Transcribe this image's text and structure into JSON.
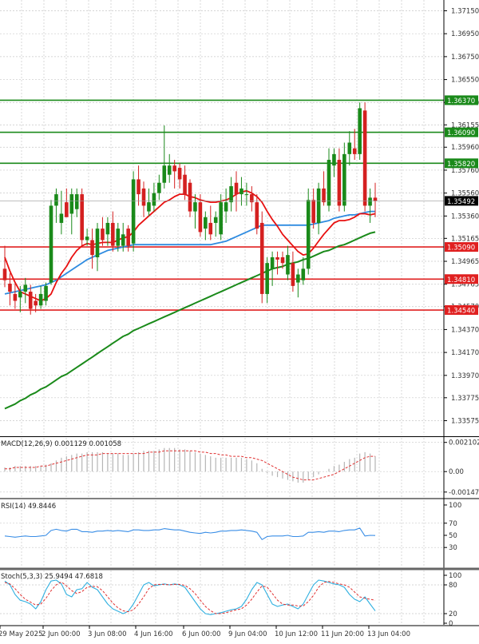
{
  "chart_data": {
    "type": "candlestick",
    "price_panel": {
      "ylim": [
        1.3346,
        1.3723
      ],
      "y_ticks": [
        "1.37150",
        "1.36950",
        "1.36750",
        "1.36550",
        "1.36350",
        "1.36155",
        "1.35960",
        "1.35760",
        "1.35560",
        "1.35360",
        "1.35165",
        "1.34965",
        "1.34765",
        "1.34570",
        "1.34370",
        "1.34170",
        "1.33970",
        "1.33775",
        "1.33575"
      ],
      "candles": [
        {
          "o": 1.349,
          "h": 1.351,
          "l": 1.3474,
          "c": 1.348
        },
        {
          "o": 1.3477,
          "h": 1.3486,
          "l": 1.3458,
          "c": 1.347
        },
        {
          "o": 1.3468,
          "h": 1.3478,
          "l": 1.3455,
          "c": 1.3462
        },
        {
          "o": 1.3465,
          "h": 1.3475,
          "l": 1.3452,
          "c": 1.347
        },
        {
          "o": 1.347,
          "h": 1.3482,
          "l": 1.346,
          "c": 1.3476
        },
        {
          "o": 1.347,
          "h": 1.3476,
          "l": 1.345,
          "c": 1.3455
        },
        {
          "o": 1.3462,
          "h": 1.3468,
          "l": 1.3452,
          "c": 1.3458
        },
        {
          "o": 1.3458,
          "h": 1.3475,
          "l": 1.3455,
          "c": 1.3468
        },
        {
          "o": 1.3462,
          "h": 1.3478,
          "l": 1.3458,
          "c": 1.3475
        },
        {
          "o": 1.3478,
          "h": 1.355,
          "l": 1.3476,
          "c": 1.3545
        },
        {
          "o": 1.3545,
          "h": 1.356,
          "l": 1.353,
          "c": 1.3555
        },
        {
          "o": 1.353,
          "h": 1.3558,
          "l": 1.352,
          "c": 1.3538
        },
        {
          "o": 1.3548,
          "h": 1.356,
          "l": 1.3535,
          "c": 1.3535
        },
        {
          "o": 1.3538,
          "h": 1.356,
          "l": 1.352,
          "c": 1.3555
        },
        {
          "o": 1.3542,
          "h": 1.356,
          "l": 1.3535,
          "c": 1.3555
        },
        {
          "o": 1.3555,
          "h": 1.356,
          "l": 1.351,
          "c": 1.3515
        },
        {
          "o": 1.3515,
          "h": 1.3525,
          "l": 1.351,
          "c": 1.3518
        },
        {
          "o": 1.3515,
          "h": 1.3525,
          "l": 1.349,
          "c": 1.3502
        },
        {
          "o": 1.35,
          "h": 1.353,
          "l": 1.3488,
          "c": 1.3525
        },
        {
          "o": 1.3525,
          "h": 1.3535,
          "l": 1.351,
          "c": 1.3515
        },
        {
          "o": 1.352,
          "h": 1.3535,
          "l": 1.351,
          "c": 1.353
        },
        {
          "o": 1.353,
          "h": 1.354,
          "l": 1.3505,
          "c": 1.351
        },
        {
          "o": 1.351,
          "h": 1.353,
          "l": 1.3505,
          "c": 1.3525
        },
        {
          "o": 1.351,
          "h": 1.353,
          "l": 1.3505,
          "c": 1.352
        },
        {
          "o": 1.3525,
          "h": 1.3528,
          "l": 1.3505,
          "c": 1.351
        },
        {
          "o": 1.3512,
          "h": 1.3575,
          "l": 1.3505,
          "c": 1.3568
        },
        {
          "o": 1.3568,
          "h": 1.358,
          "l": 1.3545,
          "c": 1.3555
        },
        {
          "o": 1.356,
          "h": 1.3566,
          "l": 1.3535,
          "c": 1.3545
        },
        {
          "o": 1.354,
          "h": 1.356,
          "l": 1.3536,
          "c": 1.3548
        },
        {
          "o": 1.3545,
          "h": 1.3565,
          "l": 1.354,
          "c": 1.3556
        },
        {
          "o": 1.3556,
          "h": 1.3572,
          "l": 1.355,
          "c": 1.3565
        },
        {
          "o": 1.3565,
          "h": 1.3615,
          "l": 1.356,
          "c": 1.358
        },
        {
          "o": 1.3572,
          "h": 1.359,
          "l": 1.3565,
          "c": 1.358
        },
        {
          "o": 1.358,
          "h": 1.3585,
          "l": 1.356,
          "c": 1.3575
        },
        {
          "o": 1.3578,
          "h": 1.3582,
          "l": 1.356,
          "c": 1.3568
        },
        {
          "o": 1.3572,
          "h": 1.358,
          "l": 1.355,
          "c": 1.3555
        },
        {
          "o": 1.3565,
          "h": 1.3568,
          "l": 1.3535,
          "c": 1.354
        },
        {
          "o": 1.354,
          "h": 1.3555,
          "l": 1.3525,
          "c": 1.3548
        },
        {
          "o": 1.3548,
          "h": 1.3555,
          "l": 1.3518,
          "c": 1.3522
        },
        {
          "o": 1.3525,
          "h": 1.354,
          "l": 1.3515,
          "c": 1.3535
        },
        {
          "o": 1.353,
          "h": 1.3545,
          "l": 1.3515,
          "c": 1.352
        },
        {
          "o": 1.353,
          "h": 1.354,
          "l": 1.3518,
          "c": 1.3535
        },
        {
          "o": 1.352,
          "h": 1.3555,
          "l": 1.3515,
          "c": 1.3548
        },
        {
          "o": 1.354,
          "h": 1.356,
          "l": 1.353,
          "c": 1.3548
        },
        {
          "o": 1.3548,
          "h": 1.357,
          "l": 1.354,
          "c": 1.3562
        },
        {
          "o": 1.3565,
          "h": 1.3575,
          "l": 1.354,
          "c": 1.3555
        },
        {
          "o": 1.3555,
          "h": 1.357,
          "l": 1.3545,
          "c": 1.356
        },
        {
          "o": 1.3555,
          "h": 1.3565,
          "l": 1.3545,
          "c": 1.3555
        },
        {
          "o": 1.3555,
          "h": 1.3562,
          "l": 1.354,
          "c": 1.3548
        },
        {
          "o": 1.3548,
          "h": 1.3555,
          "l": 1.352,
          "c": 1.3525
        },
        {
          "o": 1.353,
          "h": 1.354,
          "l": 1.346,
          "c": 1.3468
        },
        {
          "o": 1.3468,
          "h": 1.35,
          "l": 1.346,
          "c": 1.3495
        },
        {
          "o": 1.349,
          "h": 1.3505,
          "l": 1.3475,
          "c": 1.35
        },
        {
          "o": 1.35,
          "h": 1.3505,
          "l": 1.3485,
          "c": 1.3498
        },
        {
          "o": 1.35,
          "h": 1.3505,
          "l": 1.349,
          "c": 1.3495
        },
        {
          "o": 1.3485,
          "h": 1.351,
          "l": 1.348,
          "c": 1.3502
        },
        {
          "o": 1.3495,
          "h": 1.3505,
          "l": 1.347,
          "c": 1.3475
        },
        {
          "o": 1.3478,
          "h": 1.349,
          "l": 1.3465,
          "c": 1.3485
        },
        {
          "o": 1.348,
          "h": 1.35,
          "l": 1.3476,
          "c": 1.349
        },
        {
          "o": 1.349,
          "h": 1.356,
          "l": 1.3485,
          "c": 1.355
        },
        {
          "o": 1.355,
          "h": 1.356,
          "l": 1.3525,
          "c": 1.353
        },
        {
          "o": 1.353,
          "h": 1.3565,
          "l": 1.352,
          "c": 1.356
        },
        {
          "o": 1.356,
          "h": 1.3575,
          "l": 1.3545,
          "c": 1.3548
        },
        {
          "o": 1.3545,
          "h": 1.3595,
          "l": 1.354,
          "c": 1.3585
        },
        {
          "o": 1.358,
          "h": 1.3595,
          "l": 1.357,
          "c": 1.359
        },
        {
          "o": 1.3585,
          "h": 1.3595,
          "l": 1.354,
          "c": 1.3545
        },
        {
          "o": 1.3545,
          "h": 1.36,
          "l": 1.354,
          "c": 1.359
        },
        {
          "o": 1.359,
          "h": 1.361,
          "l": 1.358,
          "c": 1.36
        },
        {
          "o": 1.3595,
          "h": 1.3612,
          "l": 1.3585,
          "c": 1.359
        },
        {
          "o": 1.359,
          "h": 1.3635,
          "l": 1.3585,
          "c": 1.363
        },
        {
          "o": 1.3628,
          "h": 1.3635,
          "l": 1.354,
          "c": 1.3545
        },
        {
          "o": 1.3545,
          "h": 1.356,
          "l": 1.353,
          "c": 1.3552
        },
        {
          "o": 1.3552,
          "h": 1.3565,
          "l": 1.3535,
          "c": 1.3549
        }
      ],
      "ma_fast": [
        1.35,
        1.3488,
        1.3478,
        1.347,
        1.3468,
        1.3466,
        1.3464,
        1.3462,
        1.3464,
        1.3468,
        1.3478,
        1.3486,
        1.3492,
        1.35,
        1.3506,
        1.351,
        1.3512,
        1.3511,
        1.3512,
        1.3513,
        1.3513,
        1.3513,
        1.3515,
        1.3517,
        1.3518,
        1.3522,
        1.3528,
        1.3532,
        1.3536,
        1.354,
        1.3544,
        1.3548,
        1.355,
        1.3553,
        1.3555,
        1.3555,
        1.3553,
        1.3552,
        1.355,
        1.3549,
        1.3548,
        1.3548,
        1.3549,
        1.355,
        1.3552,
        1.3555,
        1.3557,
        1.3558,
        1.3556,
        1.3553,
        1.3548,
        1.354,
        1.3533,
        1.3527,
        1.352,
        1.3515,
        1.351,
        1.3505,
        1.3502,
        1.3503,
        1.3508,
        1.3514,
        1.352,
        1.3525,
        1.353,
        1.3532,
        1.3532,
        1.3533,
        1.3535,
        1.3538,
        1.3538,
        1.3537,
        1.3538
      ],
      "ma_mid": [
        1.3468,
        1.3469,
        1.347,
        1.3471,
        1.3472,
        1.3473,
        1.3474,
        1.3475,
        1.3476,
        1.3478,
        1.348,
        1.3483,
        1.3486,
        1.3489,
        1.3492,
        1.3495,
        1.3498,
        1.35,
        1.3502,
        1.3504,
        1.3506,
        1.3507,
        1.3508,
        1.3509,
        1.351,
        1.3511,
        1.3511,
        1.3511,
        1.3511,
        1.3511,
        1.3511,
        1.3511,
        1.3511,
        1.3511,
        1.3511,
        1.3511,
        1.3511,
        1.3511,
        1.3511,
        1.3511,
        1.3511,
        1.3512,
        1.3513,
        1.3514,
        1.3516,
        1.3518,
        1.352,
        1.3522,
        1.3524,
        1.3526,
        1.3528,
        1.3528,
        1.3528,
        1.3528,
        1.3528,
        1.3528,
        1.3528,
        1.3528,
        1.3528,
        1.3528,
        1.3529,
        1.353,
        1.3531,
        1.3532,
        1.3534,
        1.3535,
        1.3536,
        1.3537,
        1.3537,
        1.3538,
        1.3539,
        1.354,
        1.354
      ],
      "ma_slow": [
        1.3368,
        1.337,
        1.3372,
        1.3375,
        1.3377,
        1.338,
        1.3382,
        1.3385,
        1.3387,
        1.339,
        1.3393,
        1.3396,
        1.3398,
        1.3401,
        1.3404,
        1.3407,
        1.341,
        1.3413,
        1.3416,
        1.3419,
        1.3422,
        1.3425,
        1.3428,
        1.3431,
        1.3433,
        1.3436,
        1.3438,
        1.344,
        1.3442,
        1.3444,
        1.3446,
        1.3448,
        1.345,
        1.3452,
        1.3454,
        1.3456,
        1.3458,
        1.346,
        1.3462,
        1.3464,
        1.3466,
        1.3468,
        1.347,
        1.3472,
        1.3474,
        1.3476,
        1.3478,
        1.348,
        1.3482,
        1.3484,
        1.3486,
        1.3488,
        1.349,
        1.3491,
        1.3492,
        1.3494,
        1.3495,
        1.3496,
        1.3498,
        1.3499,
        1.3501,
        1.3503,
        1.3505,
        1.3506,
        1.3508,
        1.351,
        1.3511,
        1.3513,
        1.3515,
        1.3517,
        1.3519,
        1.3521,
        1.3522
      ],
      "levels": [
        {
          "value": 1.3637,
          "label": "1.36370",
          "color": "#1a8a1a"
        },
        {
          "value": 1.3609,
          "label": "1.36090",
          "color": "#1a8a1a"
        },
        {
          "value": 1.3582,
          "label": "1.35820",
          "color": "#1a8a1a"
        },
        {
          "value": 1.3509,
          "label": "1.35090",
          "color": "#e02020"
        },
        {
          "value": 1.3481,
          "label": "1.34810",
          "color": "#e02020"
        },
        {
          "value": 1.3454,
          "label": "1.34540",
          "color": "#e02020"
        }
      ],
      "current_price": {
        "value": 1.35492,
        "label": "1.35492"
      }
    },
    "macd_panel": {
      "label": "MACD(12,26,9) 0.001129 0.001058",
      "ylim": [
        -0.0016,
        0.0022
      ],
      "y_ticks": [
        "0.002102",
        "0.00",
        "-0.001475"
      ],
      "histogram": [
        0.0003,
        0.0003,
        0.0004,
        0.0004,
        0.0004,
        0.0004,
        0.0004,
        0.0004,
        0.0005,
        0.0006,
        0.0008,
        0.001,
        0.0011,
        0.0012,
        0.0013,
        0.0013,
        0.0014,
        0.0014,
        0.0014,
        0.0014,
        0.0013,
        0.0013,
        0.0013,
        0.0012,
        0.0012,
        0.0013,
        0.0014,
        0.0015,
        0.0015,
        0.0015,
        0.0016,
        0.0017,
        0.0017,
        0.0017,
        0.0016,
        0.0016,
        0.0015,
        0.0014,
        0.0013,
        0.0012,
        0.0011,
        0.001,
        0.001,
        0.001,
        0.001,
        0.001,
        0.001,
        0.0009,
        0.0008,
        0.0006,
        0.0002,
        -0.0001,
        -0.0003,
        -0.0004,
        -0.0005,
        -0.0006,
        -0.0007,
        -0.0008,
        -0.0008,
        -0.0006,
        -0.0004,
        -0.0002,
        0.0,
        0.0002,
        0.0004,
        0.0005,
        0.0007,
        0.0009,
        0.001,
        0.0013,
        0.0014,
        0.0013,
        0.0011
      ],
      "signal": [
        0.0002,
        0.0002,
        0.0003,
        0.0003,
        0.0003,
        0.0003,
        0.0003,
        0.0004,
        0.0004,
        0.0005,
        0.0006,
        0.0007,
        0.0008,
        0.0009,
        0.001,
        0.0011,
        0.0012,
        0.0012,
        0.0012,
        0.0013,
        0.0013,
        0.0013,
        0.0013,
        0.0013,
        0.0013,
        0.0013,
        0.0013,
        0.0013,
        0.0014,
        0.0014,
        0.0014,
        0.0015,
        0.0015,
        0.0015,
        0.0015,
        0.0015,
        0.0015,
        0.0015,
        0.0014,
        0.0014,
        0.0013,
        0.0013,
        0.0012,
        0.0012,
        0.0011,
        0.0011,
        0.0011,
        0.001,
        0.001,
        0.0009,
        0.0008,
        0.0006,
        0.0004,
        0.0002,
        0.0,
        -0.0002,
        -0.0004,
        -0.0005,
        -0.0006,
        -0.0006,
        -0.0006,
        -0.0005,
        -0.0004,
        -0.0003,
        -0.0002,
        0.0,
        0.0002,
        0.0004,
        0.0006,
        0.0008,
        0.001,
        0.0011,
        0.0011
      ]
    },
    "rsi_panel": {
      "label": "RSI(14) 49.8446",
      "ylim": [
        0,
        100
      ],
      "y_ticks": [
        "100",
        "70",
        "50",
        "30",
        "0"
      ],
      "values": [
        49,
        48,
        47,
        48,
        49,
        48,
        48,
        49,
        50,
        58,
        60,
        58,
        57,
        60,
        60,
        56,
        56,
        55,
        57,
        57,
        58,
        57,
        58,
        57,
        56,
        59,
        59,
        58,
        58,
        59,
        59,
        61,
        60,
        59,
        59,
        57,
        55,
        54,
        53,
        55,
        54,
        55,
        57,
        57,
        58,
        58,
        59,
        58,
        57,
        55,
        43,
        48,
        49,
        49,
        49,
        50,
        48,
        48,
        49,
        55,
        55,
        56,
        55,
        57,
        57,
        56,
        58,
        59,
        59,
        62,
        49,
        50,
        49.8
      ]
    },
    "stoch_panel": {
      "label": "Stoch(5,3,3) 25.9494 47.6818",
      "ylim": [
        0,
        100
      ],
      "y_ticks": [
        "100",
        "80",
        "20",
        "0"
      ],
      "k": [
        88,
        80,
        60,
        48,
        45,
        40,
        30,
        45,
        70,
        88,
        90,
        82,
        60,
        55,
        70,
        72,
        85,
        75,
        70,
        55,
        40,
        30,
        25,
        20,
        25,
        40,
        60,
        80,
        85,
        78,
        80,
        82,
        80,
        82,
        80,
        75,
        60,
        45,
        30,
        20,
        18,
        20,
        22,
        25,
        28,
        30,
        35,
        50,
        70,
        85,
        80,
        60,
        40,
        35,
        38,
        40,
        35,
        30,
        40,
        60,
        80,
        90,
        88,
        85,
        82,
        80,
        75,
        60,
        50,
        45,
        55,
        40,
        25.9
      ],
      "d": [
        85,
        82,
        72,
        60,
        50,
        44,
        38,
        40,
        52,
        68,
        80,
        86,
        78,
        68,
        62,
        66,
        75,
        77,
        76,
        68,
        55,
        42,
        32,
        26,
        24,
        28,
        40,
        55,
        72,
        80,
        81,
        81,
        80,
        81,
        81,
        79,
        72,
        62,
        48,
        35,
        26,
        20,
        20,
        22,
        25,
        28,
        30,
        38,
        50,
        65,
        78,
        75,
        62,
        48,
        40,
        38,
        38,
        36,
        36,
        45,
        58,
        75,
        85,
        87,
        85,
        82,
        80,
        75,
        65,
        55,
        52,
        50,
        47.7
      ]
    },
    "x_labels": [
      "29 May 2025",
      "2 Jun 00:00",
      "3 Jun 08:00",
      "4 Jun 16:00",
      "6 Jun 00:00",
      "9 Jun 04:00",
      "10 Jun 12:00",
      "11 Jun 20:00",
      "13 Jun 04:00"
    ],
    "colors": {
      "up": "#1a8a1a",
      "down": "#d42020",
      "ma_fast": "#e81010",
      "ma_mid": "#2e8be0",
      "ma_slow": "#1a8a1a",
      "macd_hist": "#b5b5b5",
      "macd_signal": "#e03030",
      "rsi": "#3a8ee6",
      "stoch_k": "#30b0e0",
      "stoch_d": "#e03030",
      "grid": "#c8c8c8",
      "current": "#000000"
    }
  }
}
